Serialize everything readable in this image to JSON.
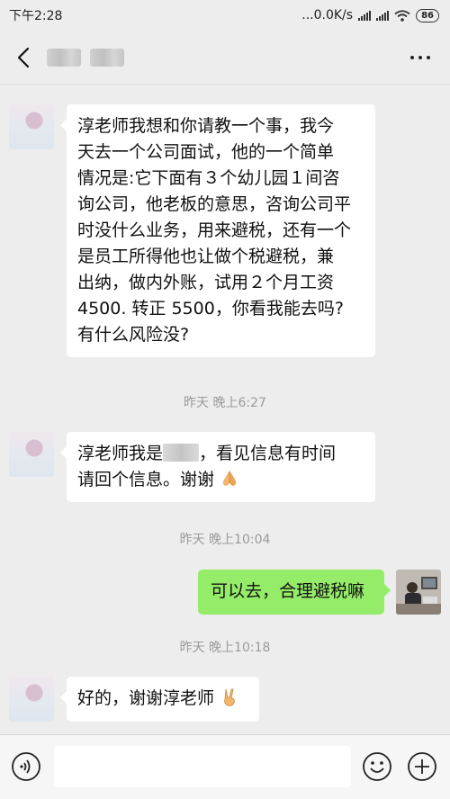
{
  "status_bar": {
    "time": "下午2:28",
    "network_speed": "...0.0K/s",
    "battery": "86"
  },
  "header": {
    "contact_name": "",
    "back_icon": "chevron-left-icon",
    "more_icon": "more-dots-icon"
  },
  "messages": [
    {
      "lines": [
        "淳老师我想和你请教一个事，我今",
        "天去一个公司面试，他的一个简单",
        "情况是:它下面有３个幼儿园１间咨",
        "询公司，他老板的意思，咨询公司平",
        "时没什么业务，用来避税，还有一个",
        "是员工所得他也让做个税避税，兼",
        "出纳，做内外账，试用２个月工资",
        "4500. 转正 5500，你看我能去吗?",
        "有什么风险没?"
      ]
    },
    {
      "line1_prefix": "淳老师我是",
      "line1_suffix": "，看见信息有时间",
      "line2": "请回个信息。谢谢",
      "emoji": "folded-hands-icon"
    },
    {
      "text": "可以去，合理避税嘛"
    },
    {
      "text": "好的，谢谢淳老师",
      "emoji": "victory-hand-icon"
    }
  ],
  "timestamps": [
    "昨天 晚上6:27",
    "昨天 晚上10:04",
    "昨天 晚上10:18"
  ],
  "bottom_bar": {
    "input_value": "",
    "voice_icon": "voice-icon",
    "emoji_icon": "emoji-icon",
    "plus_icon": "plus-icon"
  },
  "colors": {
    "background": "#ededed",
    "my_bubble": "#95ec69",
    "their_bubble": "#ffffff"
  }
}
